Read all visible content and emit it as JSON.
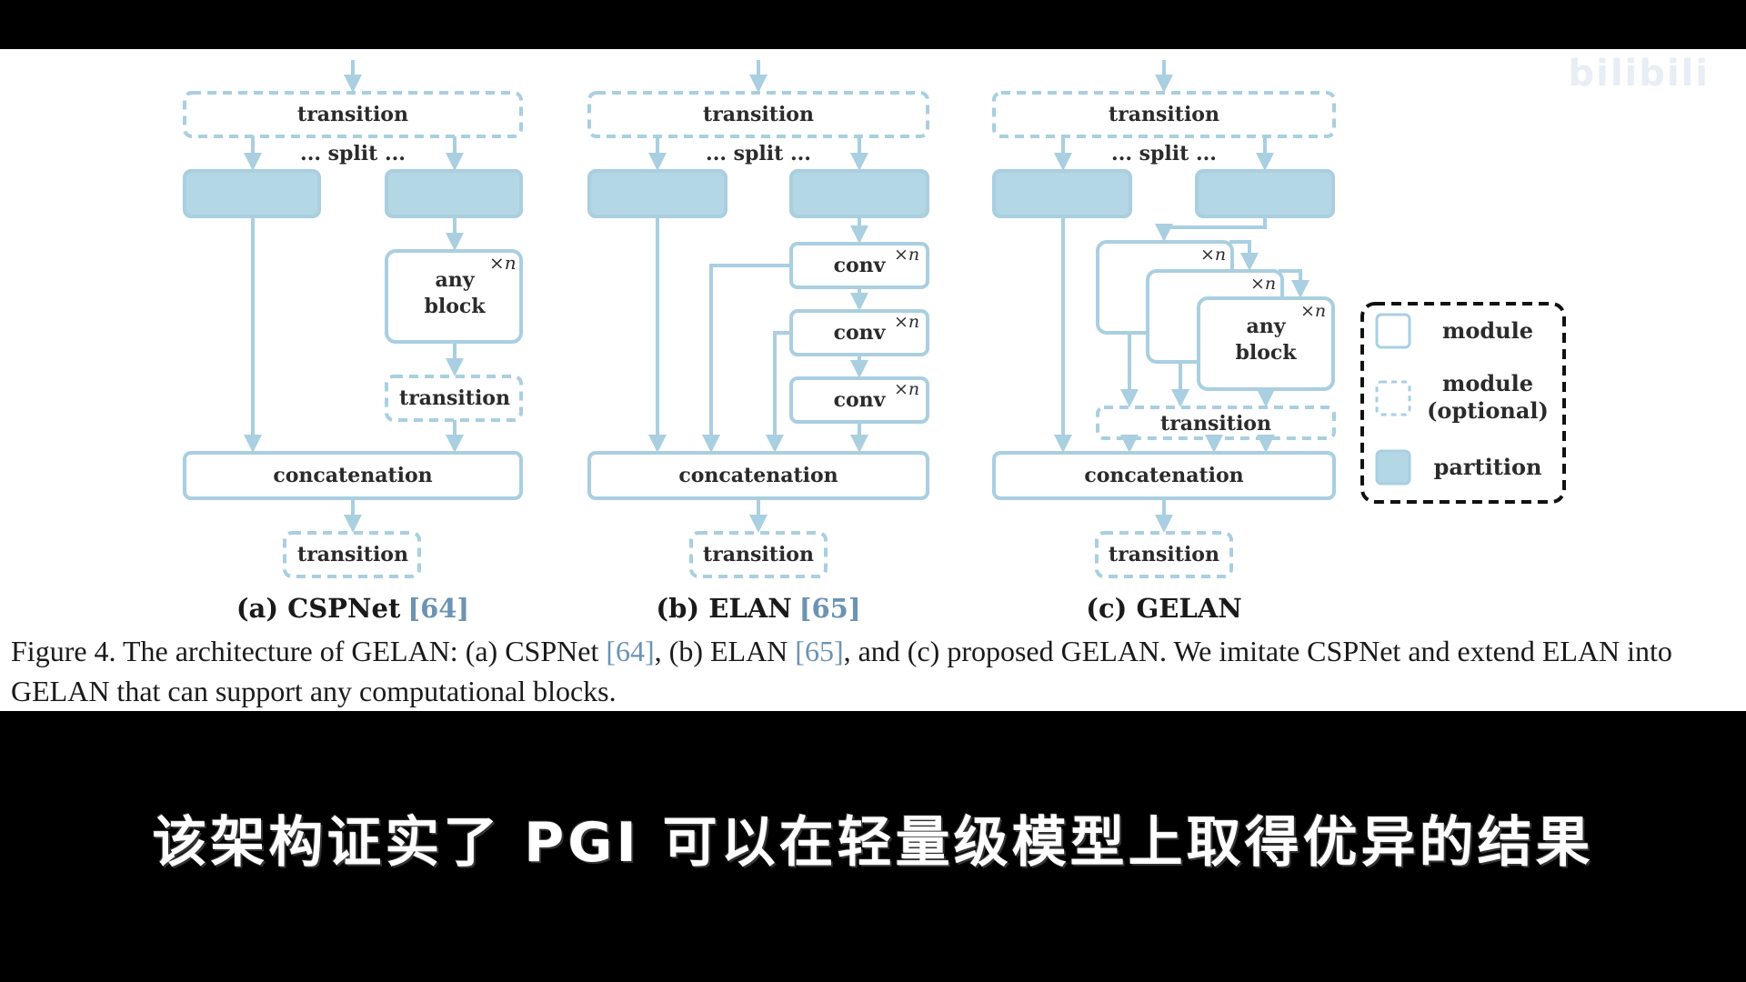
{
  "figure": {
    "subfigures": [
      {
        "id": "a",
        "caption_label": "(a) CSPNet",
        "caption_ref": "[64]",
        "labels": {
          "transition_top": "transition",
          "split": "... split ...",
          "any_block": [
            "any",
            "block"
          ],
          "xn": "×n",
          "transition_mid": "transition",
          "concatenation": "concatenation",
          "transition_bottom": "transition"
        }
      },
      {
        "id": "b",
        "caption_label": "(b) ELAN",
        "caption_ref": "[65]",
        "labels": {
          "transition_top": "transition",
          "split": "... split ...",
          "conv": "conv",
          "xn": "×n",
          "concatenation": "concatenation",
          "transition_bottom": "transition"
        }
      },
      {
        "id": "c",
        "caption_label": "(c) GELAN",
        "caption_ref": "",
        "labels": {
          "transition_top": "transition",
          "split": "... split ...",
          "any_block": [
            "any",
            "block"
          ],
          "xn": "×n",
          "transition_mid": "transition",
          "concatenation": "concatenation",
          "transition_bottom": "transition"
        }
      }
    ],
    "legend": {
      "items": [
        {
          "kind": "module",
          "label": [
            "module"
          ]
        },
        {
          "kind": "module-optional",
          "label": [
            "module",
            "(optional)"
          ]
        },
        {
          "kind": "partition",
          "label": [
            "partition"
          ]
        }
      ]
    },
    "caption": {
      "p1": "Figure 4. The architecture of GELAN: (a) CSPNet ",
      "ref1": "[64]",
      "p2": ", (b) ELAN ",
      "ref2": "[65]",
      "p3": ", and (c) proposed GELAN. We imitate CSPNet and extend ELAN into GELAN that can support any computational blocks."
    },
    "colors": {
      "line": "#a9cfe0",
      "partition_fill": "#b4d7e6",
      "text": "#2b2b2b",
      "ref": "#6b93b3"
    }
  },
  "watermark": "bilibili",
  "subtitle": "该架构证实了 PGI 可以在轻量级模型上取得优异的结果"
}
